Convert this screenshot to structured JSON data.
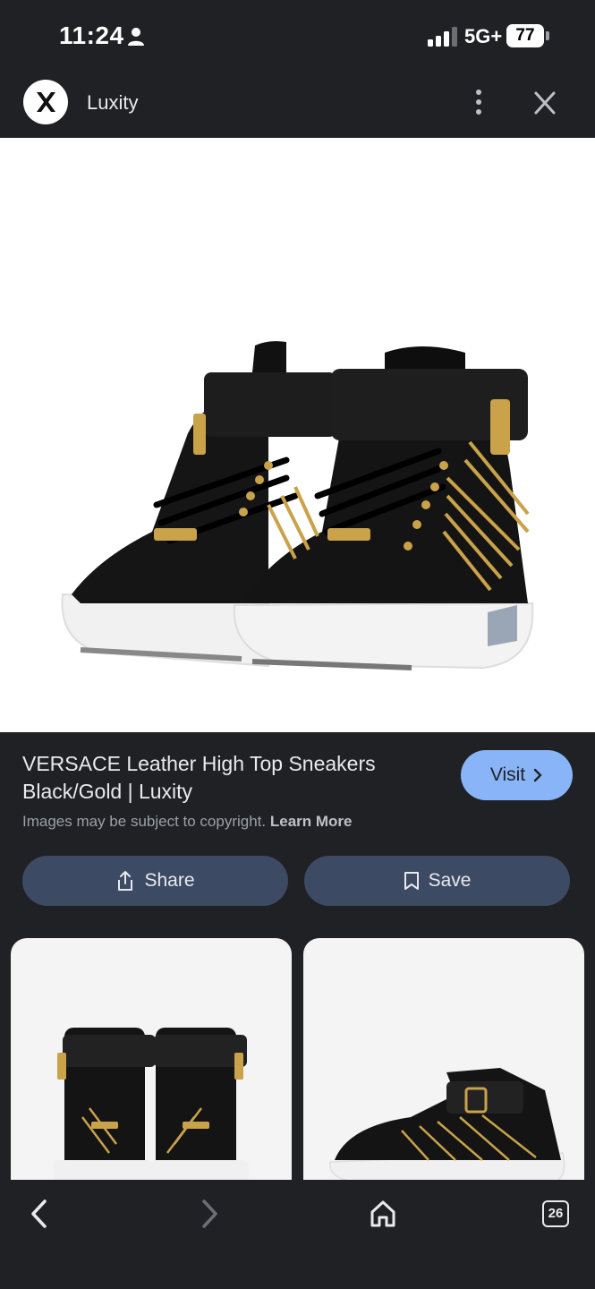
{
  "status_bar": {
    "time": "11:24",
    "network": "5G+",
    "battery": "77"
  },
  "site_header": {
    "site_name": "Luxity",
    "logo_letter": "X"
  },
  "result": {
    "title": "VERSACE Leather High Top Sneakers Black/Gold | Luxity",
    "visit_label": "Visit",
    "copyright_text": "Images may be subject to copyright.",
    "learn_more": "Learn More",
    "share_label": "Share",
    "save_label": "Save"
  },
  "bottom_nav": {
    "tabs_count": "26"
  },
  "colors": {
    "background": "#202124",
    "visit_button": "#8ab4f8",
    "action_button": "#3c4a63"
  }
}
